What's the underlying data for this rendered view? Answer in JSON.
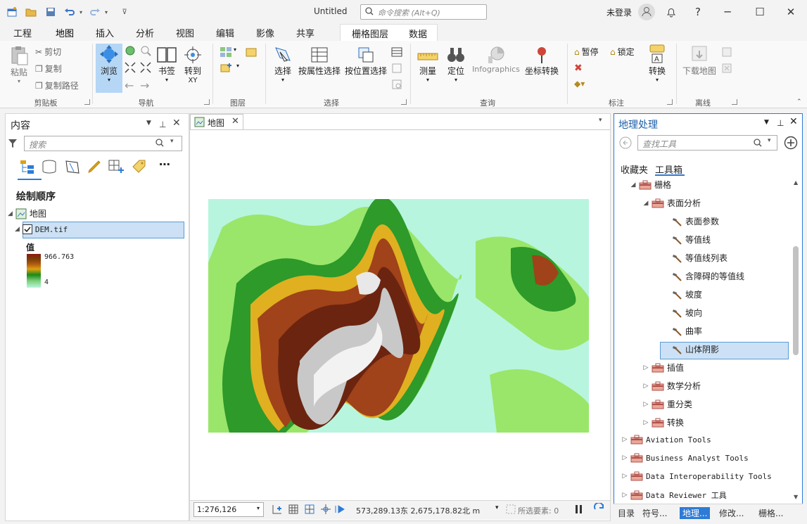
{
  "window": {
    "title": "Untitled",
    "signin": "未登录",
    "help": "?",
    "min": "─",
    "max": "☐",
    "close": "✕"
  },
  "command_search": {
    "placeholder": "命令搜索 (Alt+Q)"
  },
  "ribbon_tabs": [
    "工程",
    "地图",
    "插入",
    "分析",
    "视图",
    "编辑",
    "影像",
    "共享"
  ],
  "context_tabs": [
    "栅格图层",
    "数据"
  ],
  "ribbon": {
    "clipboard": {
      "paste": "粘贴",
      "cut": "剪切",
      "copy": "复制",
      "copy_path": "复制路径",
      "group": "剪贴板"
    },
    "navigate": {
      "explore": "浏览",
      "bookmarks": "书签",
      "goto": "转到",
      "goto_sub": "XY",
      "group": "导航"
    },
    "layer": {
      "group": "图层"
    },
    "selection": {
      "select": "选择",
      "by_attr": "按属性选择",
      "by_loc": "按位置选择",
      "group": "选择"
    },
    "inquiry": {
      "measure": "测量",
      "locate": "定位",
      "infographics": "Infographics",
      "convert_coords": "坐标转换",
      "group": "查询"
    },
    "labeling": {
      "pause": "暂停",
      "lock": "锁定",
      "convert": "转换",
      "group": "标注"
    },
    "offline": {
      "download": "下载地图",
      "group": "离线"
    }
  },
  "contents": {
    "title": "内容",
    "search_placeholder": "搜索",
    "drawing_order": "绘制顺序",
    "map_label": "地图",
    "layer_name": "DEM.tif",
    "legend_title": "值",
    "legend_max": "966.763",
    "legend_min": "4"
  },
  "map_view": {
    "tab_label": "地图",
    "scale": "1:276,126",
    "coords": "573,289.13东 2,675,178.82北 m",
    "selected_features": "所选要素: 0"
  },
  "geoprocessing": {
    "title": "地理处理",
    "search_placeholder": "查找工具",
    "tabs": [
      "收藏夹",
      "工具箱"
    ],
    "tree": [
      {
        "label": "栅格",
        "level": 0,
        "twisty": "◢",
        "kind": "toolbox"
      },
      {
        "label": "表面分析",
        "level": 1,
        "twisty": "◢",
        "kind": "toolset"
      },
      {
        "label": "表面参数",
        "level": 2,
        "twisty": "",
        "kind": "tool"
      },
      {
        "label": "等值线",
        "level": 2,
        "twisty": "",
        "kind": "tool"
      },
      {
        "label": "等值线列表",
        "level": 2,
        "twisty": "",
        "kind": "tool"
      },
      {
        "label": "含障碍的等值线",
        "level": 2,
        "twisty": "",
        "kind": "tool"
      },
      {
        "label": "坡度",
        "level": 2,
        "twisty": "",
        "kind": "tool"
      },
      {
        "label": "坡向",
        "level": 2,
        "twisty": "",
        "kind": "tool"
      },
      {
        "label": "曲率",
        "level": 2,
        "twisty": "",
        "kind": "tool"
      },
      {
        "label": "山体阴影",
        "level": 2,
        "twisty": "",
        "kind": "tool"
      },
      {
        "label": "插值",
        "level": 1,
        "twisty": "▷",
        "kind": "toolset"
      },
      {
        "label": "数学分析",
        "level": 1,
        "twisty": "▷",
        "kind": "toolset"
      },
      {
        "label": "重分类",
        "level": 1,
        "twisty": "▷",
        "kind": "toolset"
      },
      {
        "label": "转换",
        "level": 1,
        "twisty": "▷",
        "kind": "toolset"
      },
      {
        "label": "Aviation Tools",
        "level": -1,
        "twisty": "▷",
        "kind": "toolbox"
      },
      {
        "label": "Business Analyst Tools",
        "level": -1,
        "twisty": "▷",
        "kind": "toolbox"
      },
      {
        "label": "Data Interoperability Tools",
        "level": -1,
        "twisty": "▷",
        "kind": "toolbox"
      },
      {
        "label": "Data Reviewer 工具",
        "level": -1,
        "twisty": "▷",
        "kind": "toolbox"
      }
    ],
    "bottom_tabs": [
      "目录",
      "符号...",
      "地理...",
      "修改...",
      "栅格..."
    ]
  },
  "colors": {
    "accent": "#2d7bd6",
    "selection": "#cce1f5",
    "toolbox_icon": "#c0504d"
  }
}
